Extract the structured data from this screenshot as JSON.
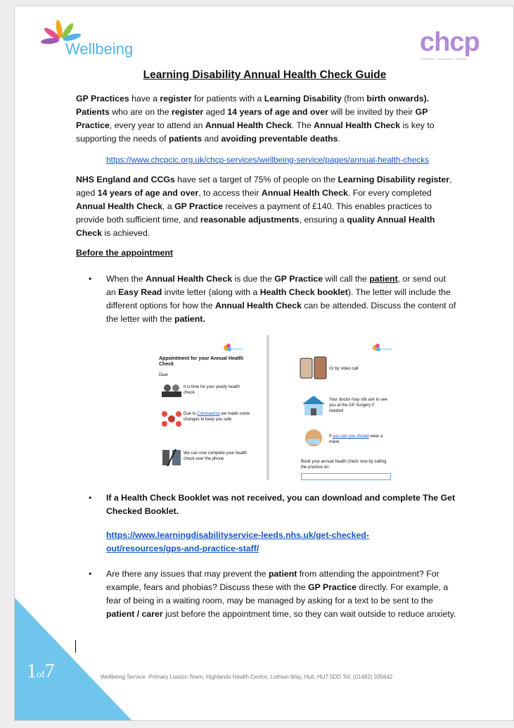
{
  "logos": {
    "left_text": "Wellbeing",
    "right_text": "chcp",
    "right_tagline": "Excellence · Compassion · Expertise"
  },
  "title": "Learning Disability Annual Health Check Guide",
  "para1": {
    "t1": "GP Practices",
    "t2": " have a ",
    "t3": "register",
    "t4": " for patients with a ",
    "t5": "Learning Disability",
    "t6": " (from ",
    "t7": "birth",
    "t8": " onwards).",
    "t9": "Patients",
    "t10": " who are on the ",
    "t11": "register",
    "t12": " aged ",
    "t13": "14 years of age and over",
    "t14": " will be invited by their ",
    "t15": "GP Practice",
    "t16": ", every year to attend an ",
    "t17": "Annual Health Check",
    "t18": ". The ",
    "t19": "Annual Health Check",
    "t20": " is key to supporting the needs of ",
    "t21": "patients",
    "t22": " and ",
    "t23": "avoiding preventable deaths",
    "t24": "."
  },
  "link1": "https://www.chcpcic.org.uk/chcp-services/wellbeing-service/pages/annual-health-checks",
  "para2": {
    "t1": "NHS England and CCGs",
    "t2": " have set a target of 75% of people on the ",
    "t3": "Learning Disability register",
    "t4": ", aged ",
    "t5": "14 years of age and over",
    "t6": ", to access their ",
    "t7": "Annual Health Check",
    "t8": ". For every completed ",
    "t9": "Annual Health Check",
    "t10": ", a ",
    "t11": "GP Practice",
    "t12": " receives a payment of £140. This enables practices to provide both sufficient time, and ",
    "t13": "reasonable adjustments",
    "t14": ", ensuring a ",
    "t15": "quality Annual Health Check",
    "t16": " is achieved."
  },
  "section_heading": "Before the appointment",
  "bullet_char": "•",
  "bullet1": {
    "t1": "When the ",
    "t2": "Annual Health Check",
    "t3": " is due the ",
    "t4": "GP Practice",
    "t5": " will call the ",
    "t6": "patient",
    "t7": ", or send out an ",
    "t8": "Easy Read",
    "t9": " invite letter (along with a ",
    "t10": "Health Check booklet",
    "t11": "). The letter will include the different options for how the ",
    "t12": "Annual Health Check",
    "t13": " can be attended. Discuss the content of the letter with the ",
    "t14": "patient."
  },
  "inset": {
    "left_logo": "Wellbeing",
    "right_logo": "Wellbeing",
    "heading": "Appointment for your Annual Health Check",
    "dear": "Dear",
    "item1": "It is time for your yearly health check.",
    "item2a": "Due to ",
    "item2b": "Coronavirus",
    "item2c": " we made some changes to keep you safe",
    "item3": "We can now complete your health check over the phone",
    "item4": "Or by video call",
    "item5": "Your doctor may still ask to see you at the GP Surgery if needed",
    "item6a": "If ",
    "item6b": "you can you should",
    "item6c": " wear a mask",
    "book": "Book your annual health check now by calling the practice on:"
  },
  "bullet2": "If a Health Check Booklet was not received, you can download and complete The Get Checked Booklet.",
  "link2": "https://www.learningdisabilityservice-leeds.nhs.uk/get-checked-out/resources/gps-and-practice-staff/",
  "bullet3": {
    "t1": "Are there any issues that may prevent the ",
    "t2": "patient",
    "t3": " from attending the appointment? For example, fears and phobias? Discuss these with the ",
    "t4": "GP Practice",
    "t5": " directly. For example, a fear of being in a waiting room, may be managed by asking for a text to be sent to the ",
    "t6": "patient / carer",
    "t7": " just before the appointment time, so they can wait outside to reduce anxiety."
  },
  "page_number": {
    "current": "1",
    "of": "of",
    "total": "7"
  },
  "footer": "Wellbeing Service -Primary Liaison Team, Highlands Health Centre, Lothian Way, Hull, HU7 5DD Tel: (01482) 335642",
  "colors": {
    "accent": "#6fc5ec",
    "link": "#1155cc",
    "chcp": "#b28ad6"
  }
}
